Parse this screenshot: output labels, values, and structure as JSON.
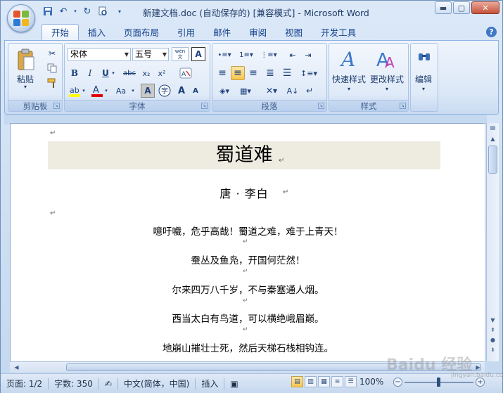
{
  "window": {
    "title": "新建文档.doc (自动保存的) [兼容模式] - Microsoft Word",
    "controls": {
      "minimize": "▬",
      "maximize": "▢",
      "close": "✕"
    }
  },
  "ribbon": {
    "tabs": [
      {
        "label": "开始",
        "active": true
      },
      {
        "label": "插入"
      },
      {
        "label": "页面布局"
      },
      {
        "label": "引用"
      },
      {
        "label": "邮件"
      },
      {
        "label": "审阅"
      },
      {
        "label": "视图"
      },
      {
        "label": "开发工具"
      }
    ],
    "groups": {
      "clipboard": {
        "label": "剪贴板",
        "paste": "粘贴"
      },
      "font": {
        "label": "字体",
        "font_name": "宋体",
        "font_size": "五号",
        "wen": "wén 文",
        "bold": "B",
        "italic": "I",
        "underline": "U",
        "strike": "abc",
        "subscript": "x₂",
        "superscript": "x²",
        "aa": "Aa",
        "grow": "A",
        "shrink": "A"
      },
      "paragraph": {
        "label": "段落"
      },
      "styles": {
        "label": "样式",
        "quick": "快速样式",
        "change": "更改样式"
      },
      "editing": {
        "label": "编辑"
      }
    }
  },
  "document": {
    "title": "蜀道难",
    "author": "唐 · 李白",
    "verses": [
      "噫吁嚱，危乎高哉！蜀道之难，难于上青天！",
      "蚕丛及鱼凫，开国何茫然！",
      "尔来四万八千岁，不与秦塞通人烟。",
      "西当太白有鸟道，可以横绝峨眉巅。",
      "地崩山摧壮士死，然后天梯石栈相钩连。"
    ],
    "para_mark": "↵"
  },
  "status": {
    "page": "页面: 1/2",
    "words": "字数: 350",
    "language": "中文(简体，中国)",
    "mode": "插入",
    "zoom": "100%"
  },
  "watermark": {
    "text": "Baidu 经验",
    "sub": "jingyan.baidu.com"
  },
  "colors": {
    "accent": "#15428b",
    "title_band": "#eeece1"
  }
}
